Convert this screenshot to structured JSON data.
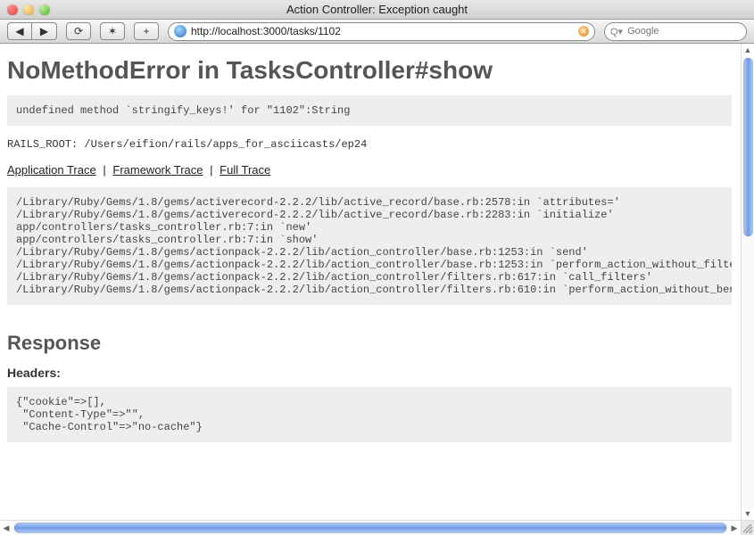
{
  "window": {
    "title": "Action Controller: Exception caught"
  },
  "toolbar": {
    "back_icon_label": "◀",
    "forward_icon_label": "▶",
    "reload_icon_label": "⟳",
    "bookmark_icon_label": "✶",
    "add_icon_label": "+",
    "url": "http://localhost:3000/tasks/1102",
    "stop_icon_label": "✕",
    "search_placeholder": "Google"
  },
  "page": {
    "heading": "NoMethodError in TasksController#show",
    "error_message": "undefined method `stringify_keys!' for \"1102\":String",
    "rails_root_label": "RAILS_ROOT:",
    "rails_root_value": "/Users/eifion/rails/apps_for_asciicasts/ep24",
    "trace_links": {
      "application": "Application Trace",
      "framework": "Framework Trace",
      "full": "Full Trace"
    },
    "trace": "/Library/Ruby/Gems/1.8/gems/activerecord-2.2.2/lib/active_record/base.rb:2578:in `attributes='\n/Library/Ruby/Gems/1.8/gems/activerecord-2.2.2/lib/active_record/base.rb:2283:in `initialize'\napp/controllers/tasks_controller.rb:7:in `new'\napp/controllers/tasks_controller.rb:7:in `show'\n/Library/Ruby/Gems/1.8/gems/actionpack-2.2.2/lib/action_controller/base.rb:1253:in `send'\n/Library/Ruby/Gems/1.8/gems/actionpack-2.2.2/lib/action_controller/base.rb:1253:in `perform_action_without_filters'\n/Library/Ruby/Gems/1.8/gems/actionpack-2.2.2/lib/action_controller/filters.rb:617:in `call_filters'\n/Library/Ruby/Gems/1.8/gems/actionpack-2.2.2/lib/action_controller/filters.rb:610:in `perform_action_without_benchma",
    "response_heading": "Response",
    "headers_label": "Headers",
    "headers_block": "{\"cookie\"=>[],\n \"Content-Type\"=>\"\",\n \"Cache-Control\"=>\"no-cache\"}"
  }
}
